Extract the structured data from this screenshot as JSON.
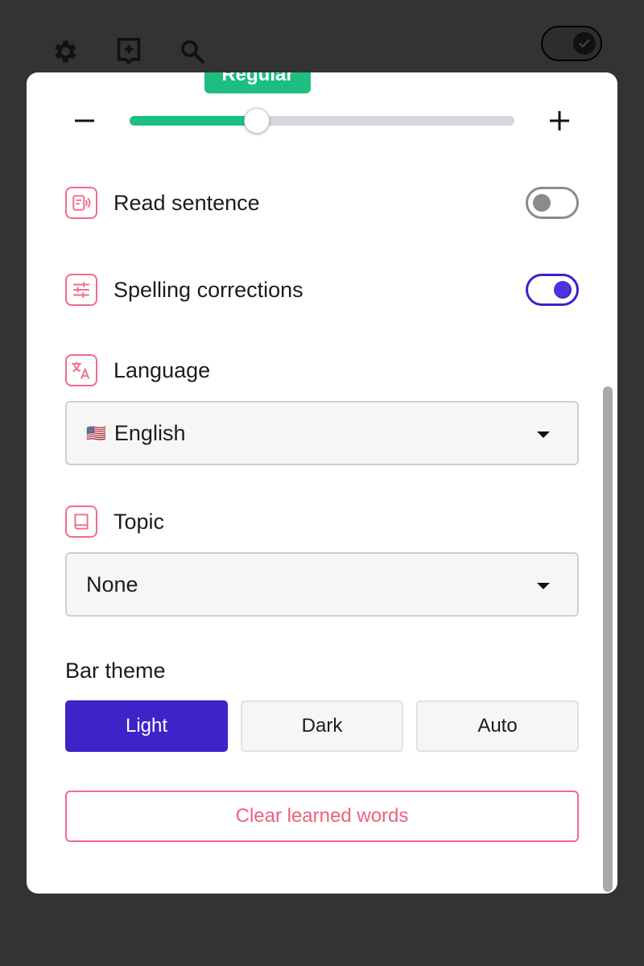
{
  "toolbar": {
    "icons": [
      "gear-icon",
      "feedback-icon",
      "search-icon"
    ],
    "dark_mode_toggle_on": true
  },
  "size_slider": {
    "badge": "Regular",
    "level_fraction": 0.33,
    "decrease_glyph": "−",
    "increase_glyph": "+"
  },
  "settings": {
    "read_sentence": {
      "label": "Read sentence",
      "icon": "read-aloud-icon",
      "enabled": false
    },
    "spelling": {
      "label": "Spelling corrections",
      "icon": "sliders-icon",
      "enabled": true
    },
    "language": {
      "label": "Language",
      "icon": "translate-icon",
      "flag": "🇺🇸",
      "value": "English"
    },
    "topic": {
      "label": "Topic",
      "icon": "book-icon",
      "value": "None"
    }
  },
  "bar_theme": {
    "title": "Bar theme",
    "options": [
      "Light",
      "Dark",
      "Auto"
    ],
    "selected": "Light"
  },
  "clear_button": "Clear learned words",
  "colors": {
    "accent": "#3d24c9",
    "slider_fill": "#1cbf7f",
    "danger": "#f36b88"
  }
}
